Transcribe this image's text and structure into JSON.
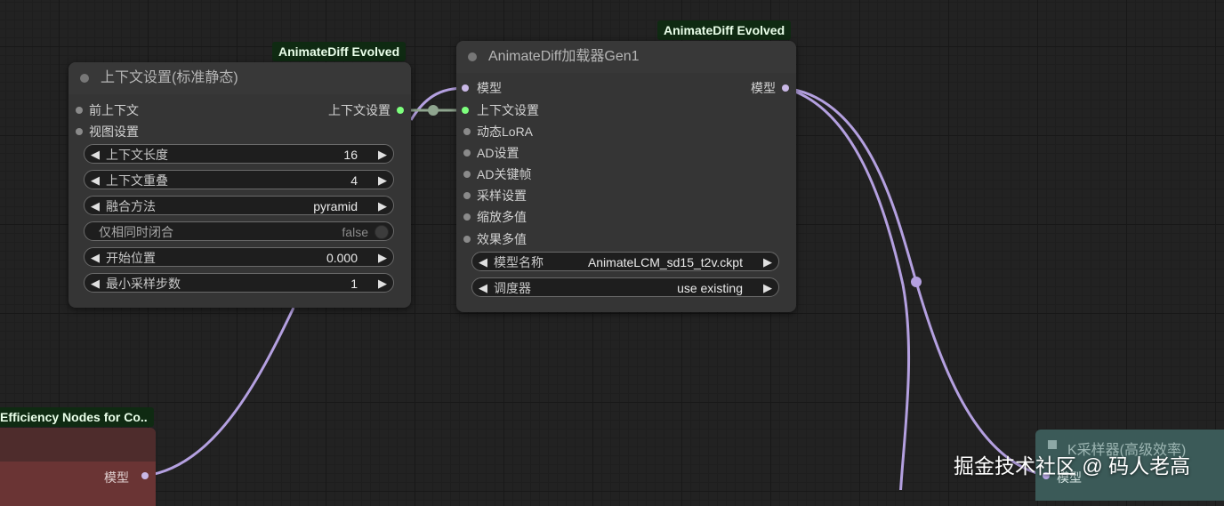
{
  "colors": {
    "canvas_bg": "#222222",
    "node_bg": "#353535",
    "badge_bg": "#0f2a12",
    "model_link": "#b4a0e0",
    "context_link": "#8fa58f",
    "context_slot": "#7dff7d",
    "model_slot": "#c9b8e6",
    "efficiency_node": "#6a3434",
    "ksampler_node": "#3b5a58"
  },
  "context_node": {
    "badge": "AnimateDiff Evolved",
    "title": "上下文设置(标准静态)",
    "inputs": [
      "前上下文",
      "视图设置"
    ],
    "output": "上下文设置",
    "widgets": [
      {
        "label": "上下文长度",
        "value": "16"
      },
      {
        "label": "上下文重叠",
        "value": "4"
      },
      {
        "label": "融合方法",
        "value": "pyramid"
      },
      {
        "label": "仅相同时闭合",
        "value": "false"
      },
      {
        "label": "开始位置",
        "value": "0.000"
      },
      {
        "label": "最小采样步数",
        "value": "1"
      }
    ]
  },
  "loader_node": {
    "badge": "AnimateDiff Evolved",
    "title": "AnimateDiff加载器Gen1",
    "inputs": [
      "模型",
      "上下文设置",
      "动态LoRA",
      "AD设置",
      "AD关键帧",
      "采样设置",
      "缩放多值",
      "效果多值"
    ],
    "output": "模型",
    "widgets": [
      {
        "label": "模型名称",
        "value": "AnimateLCM_sd15_t2v.ckpt"
      },
      {
        "label": "调度器",
        "value": "use existing"
      }
    ]
  },
  "efficiency_node": {
    "badge": "Efficiency Nodes for Co..",
    "output": "模型"
  },
  "ksampler_node": {
    "title": "K采样器(高级效率)",
    "input": "模型"
  },
  "watermark": "掘金技术社区 @ 码人老高",
  "icons": {
    "arrow_left": "◀",
    "arrow_right": "▶"
  }
}
